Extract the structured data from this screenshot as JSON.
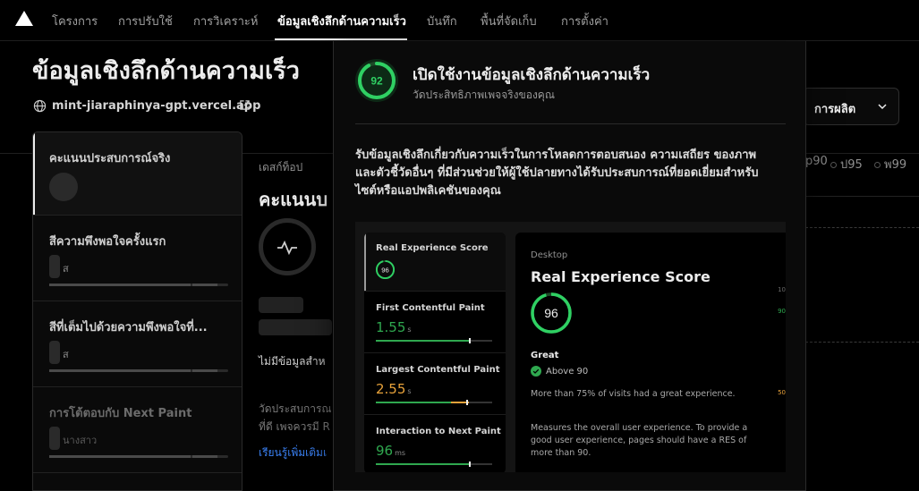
{
  "nav": {
    "tabs": [
      {
        "label": "โครงการ"
      },
      {
        "label": "การปรับใช้"
      },
      {
        "label": "การวิเคราะห์"
      },
      {
        "label": "ข้อมูลเชิงลึกด้านความเร็ว"
      },
      {
        "label": "บันทึก"
      },
      {
        "label": "พื้นที่จัดเก็บ"
      },
      {
        "label": "การตั้งค่า"
      }
    ],
    "active_index": 3
  },
  "page": {
    "title": "ข้อมูลเชิงลึกด้านความเร็ว",
    "domain": "mint-jiaraphinya-gpt.vercel.app",
    "environment": "การผลิต",
    "percentiles": [
      "p90",
      "ป95",
      "พ99"
    ]
  },
  "metrics": [
    {
      "name": "คะแนนประสบการณ์จริง",
      "unit": ""
    },
    {
      "name": "สีความพึงพอใจครั้งแรก",
      "unit": "ส"
    },
    {
      "name": "สีที่เต็มไปด้วยความพึงพอใจที่...",
      "unit": "ส"
    },
    {
      "name": "การโต้ตอบกับ Next Paint",
      "unit": "นางสาว"
    }
  ],
  "detail": {
    "device": "เดสก์ท็อป",
    "heading": "คะแนนบ",
    "no_data": "ไม่มีข้อมูลสำห",
    "desc_line1": "วัดประสบการณ",
    "desc_line2": "ที่ดี เพจควรมี R",
    "learn_more": "เรียนรู้เพิ่มเติมเ"
  },
  "popover": {
    "score": "92",
    "title": "เปิดใช้งานข้อมูลเชิงลึกด้านความเร็ว",
    "subtitle": "วัดประสิทธิภาพเพจจริงของคุณ",
    "body": "รับข้อมูลเชิงลึกเกี่ยวกับความเร็วในการโหลดการตอบสนอง ความเสถียร ของภาพ และตัวชี้วัดอื่นๆ ที่มีส่วนช่วยให้ผู้ใช้ปลายทางได้รับประสบการณ์ที่ยอดเยี่ยมสำหรับไซต์หรือแอปพลิเคชันของคุณ",
    "preview": {
      "items": [
        {
          "name": "Real Experience Score",
          "score": "96"
        },
        {
          "name": "First Contentful Paint",
          "value": "1.55",
          "unit": "s",
          "progress": 0.8
        },
        {
          "name": "Largest Contentful Paint",
          "value": "2.55",
          "unit": "s",
          "progress": 0.78
        },
        {
          "name": "Interaction to Next Paint",
          "value": "96",
          "unit": "ms",
          "progress": 0.8
        }
      ],
      "detail": {
        "device": "Desktop",
        "title": "Real Experience Score",
        "score": "96",
        "rating": "Great",
        "threshold": "Above 90",
        "visits": "More than 75% of visits had a great experience.",
        "description": "Measures the overall user experience. To provide a good user experience, pages should have a RES of more than 90.",
        "side_labels": [
          "10",
          "90",
          "50"
        ]
      }
    }
  },
  "colors": {
    "good": "#2fa84f",
    "needs_improvement": "#e8a23a",
    "link": "#3b82f6"
  }
}
